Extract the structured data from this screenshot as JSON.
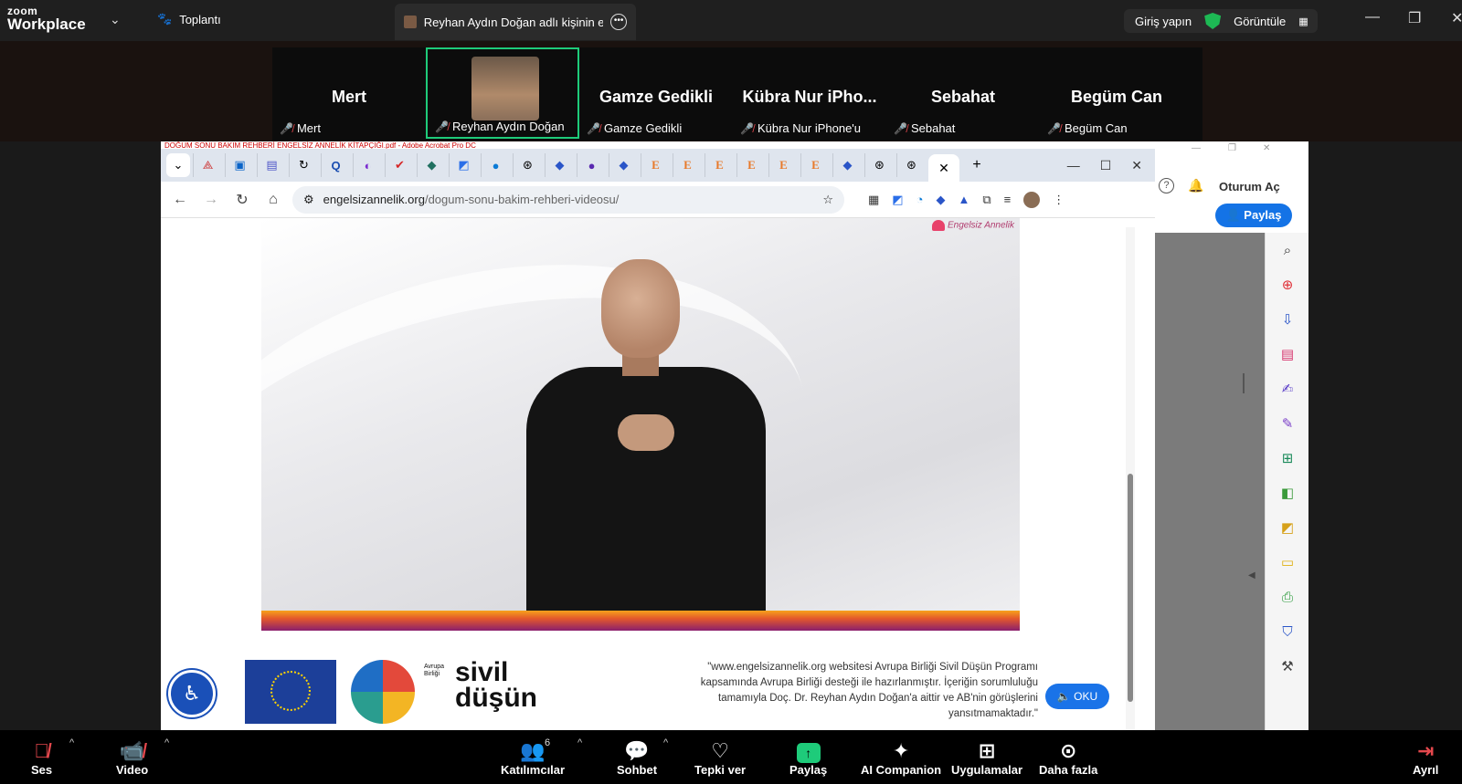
{
  "zoom": {
    "logo_small": "zoom",
    "logo_big": "Workplace",
    "meeting_label": "Toplantı",
    "share_tab_label": "Reyhan Aydın Doğan adlı kişinin e",
    "login_label": "Giriş yapın",
    "view_label": "Görüntüle",
    "participants": [
      {
        "big": "Mert",
        "small": "Mert"
      },
      {
        "big": "",
        "small": "Reyhan Aydın Doğan"
      },
      {
        "big": "Gamze Gedikli",
        "small": "Gamze Gedikli"
      },
      {
        "big": "Kübra Nur iPho...",
        "small": "Kübra Nur iPhone'u"
      },
      {
        "big": "Sebahat",
        "small": "Sebahat"
      },
      {
        "big": "Begüm Can",
        "small": "Begüm Can"
      }
    ],
    "toolbar": {
      "audio": "Ses",
      "video": "Video",
      "participants": "Katılımcılar",
      "participants_count": "6",
      "chat": "Sohbet",
      "react": "Tepki ver",
      "share": "Paylaş",
      "ai": "AI Companion",
      "apps": "Uygulamalar",
      "more": "Daha fazla",
      "leave": "Ayrıl"
    }
  },
  "pdf_window_title": "DOĞUM SONU BAKIM REHBERİ ENGELSİZ ANNELİK KİTAPÇIĞI.pdf - Adobe Acrobat Pro DC",
  "browser": {
    "url_host": "engelsizannelik.org",
    "url_path": "/dogum-sonu-bakim-rehberi-videosu/",
    "tab_icons": [
      "adobe",
      "outlook",
      "teams",
      "app",
      "Q",
      "app",
      "check",
      "app",
      "translate",
      "edge",
      "openai",
      "app",
      "app",
      "app",
      "E",
      "E",
      "E",
      "E",
      "E",
      "E",
      "app",
      "openai",
      "openai"
    ]
  },
  "page": {
    "brand_logo": "Engelsiz Annelik",
    "eu_label": "Avrupa Birliği",
    "sivil_label": "sivil",
    "dusun_label": "düşün",
    "disclaimer_line1": "\"www.engelsizannelik.org websitesi Avrupa Birliği Sivil Düşün Programı",
    "disclaimer_line2": "kapsamında Avrupa Birliği desteği ile hazırlanmıştır. İçeriğin sorumluluğu",
    "disclaimer_line3": "tamamıyla Doç. Dr. Reyhan Aydın Doğan'a aittir ve AB'nin görüşlerini",
    "disclaimer_line4": "yansıtmamaktadır.\"",
    "oku_label": "OKU"
  },
  "acrobat": {
    "signin": "Oturum Aç",
    "share": "Paylaş"
  }
}
